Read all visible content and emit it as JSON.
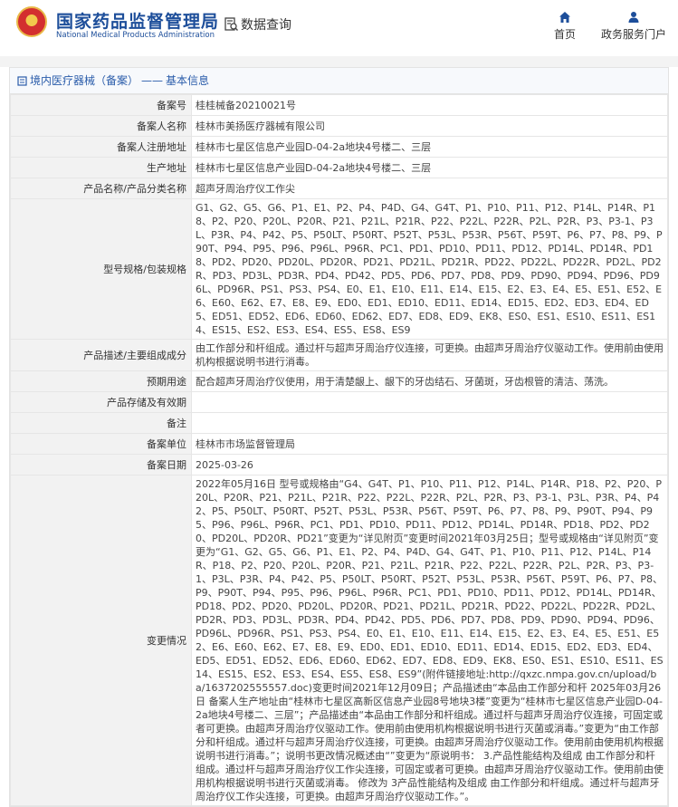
{
  "header": {
    "org_cn": "国家药品监督管理局",
    "org_en": "National Medical Products Administration",
    "query_label": "数据查询",
    "nav": [
      {
        "label": "首页"
      },
      {
        "label": "政务服务门户"
      }
    ]
  },
  "panel": {
    "breadcrumb": "境内医疗器械（备案）",
    "sep": "——",
    "section": "基本信息"
  },
  "rows": [
    {
      "label": "备案号",
      "value": "桂桂械备20210021号"
    },
    {
      "label": "备案人名称",
      "value": "桂林市美扬医疗器械有限公司"
    },
    {
      "label": "备案人注册地址",
      "value": "桂林市七星区信息产业园D-04-2a地块4号楼二、三层"
    },
    {
      "label": "生产地址",
      "value": "桂林市七星区信息产业园D-04-2a地块4号楼二、三层"
    },
    {
      "label": "产品名称/产品分类名称",
      "value": "超声牙周治疗仪工作尖"
    },
    {
      "label": "型号规格/包装规格",
      "value": "G1、G2、G5、G6、P1、E1、P2、P4、P4D、G4、G4T、P1、P10、P11、P12、P14L、P14R、P18、P2、P20、P20L、P20R、P21、P21L、P21R、P22、P22L、P22R、P2L、P2R、P3、P3-1、P3L、P3R、P4、P42、P5、P50LT、P50RT、P52T、P53L、P53R、P56T、P59T、P6、P7、P8、P9、P90T、P94、P95、P96、P96L、P96R、PC1、PD1、PD10、PD11、PD12、PD14L、PD14R、PD18、PD2、PD20、PD20L、PD20R、PD21、PD21L、PD21R、PD22、PD22L、PD22R、PD2L、PD2R、PD3、PD3L、PD3R、PD4、PD42、PD5、PD6、PD7、PD8、PD9、PD90、PD94、PD96、PD96L、PD96R、PS1、PS3、PS4、E0、E1、E10、E11、E14、E15、E2、E3、E4、E5、E51、E52、E6、E60、E62、E7、E8、E9、ED0、ED1、ED10、ED11、ED14、ED15、ED2、ED3、ED4、ED5、ED51、ED52、ED6、ED60、ED62、ED7、ED8、ED9、EK8、ES0、ES1、ES10、ES11、ES14、ES15、ES2、ES3、ES4、ES5、ES8、ES9"
    },
    {
      "label": "产品描述/主要组成成分",
      "value": "由工作部分和杆组成。通过杆与超声牙周治疗仪连接，可更换。由超声牙周治疗仪驱动工作。使用前由使用机构根据说明书进行消毒。"
    },
    {
      "label": "预期用途",
      "value": "配合超声牙周治疗仪使用，用于清楚龈上、龈下的牙齿结石、牙菌斑，牙齿根管的清洁、荡洗。"
    },
    {
      "label": "产品存储及有效期",
      "value": ""
    },
    {
      "label": "备注",
      "value": ""
    },
    {
      "label": "备案单位",
      "value": "桂林市市场监督管理局"
    },
    {
      "label": "备案日期",
      "value": "2025-03-26"
    },
    {
      "label": "变更情况",
      "value": "2022年05月16日 型号或规格由“G4、G4T、P1、P10、P11、P12、P14L、P14R、P18、P2、P20、P20L、P20R、P21、P21L、P21R、P22、P22L、P22R、P2L、P2R、P3、P3-1、P3L、P3R、P4、P42、P5、P50LT、P50RT、P52T、P53L、P53R、P56T、P59T、P6、P7、P8、P9、P90T、P94、P95、P96、P96L、P96R、PC1、PD1、PD10、PD11、PD12、PD14L、PD14R、PD18、PD2、PD20、PD20L、PD20R、PD21”变更为“详见附页”变更时间2021年03月25日；型号或规格由“详见附页”变更为“G1、G2、G5、G6、P1、E1、P2、P4、P4D、G4、G4T、P1、P10、P11、P12、P14L、P14R、P18、P2、P20、P20L、P20R、P21、P21L、P21R、P22、P22L、P22R、P2L、P2R、P3、P3-1、P3L、P3R、P4、P42、P5、P50LT、P50RT、P52T、P53L、P53R、P56T、P59T、P6、P7、P8、P9、P90T、P94、P95、P96、P96L、P96R、PC1、PD1、PD10、PD11、PD12、PD14L、PD14R、PD18、PD2、PD20、PD20L、PD20R、PD21、PD21L、PD21R、PD22、PD22L、PD22R、PD2L、PD2R、PD3、PD3L、PD3R、PD4、PD42、PD5、PD6、PD7、PD8、PD9、PD90、PD94、PD96、PD96L、PD96R、PS1、PS3、PS4、E0、E1、E10、E11、E14、E15、E2、E3、E4、E5、E51、E52、E6、E60、E62、E7、E8、E9、ED0、ED1、ED10、ED11、ED14、ED15、ED2、ED3、ED4、ED5、ED51、ED52、ED6、ED60、ED62、ED7、ED8、ED9、EK8、ES0、ES1、ES10、ES11、ES14、ES15、ES2、ES3、ES4、ES5、ES8、ES9”(附件链接地址:http://qxzc.nmpa.gov.cn/upload/ba/1637202555557.doc)变更时间2021年12月09日；产品描述由“本品由工作部分和杆 2025年03月26日 备案人生产地址由“桂林市七星区高新区信息产业园8号地块3楼”变更为“桂林市七星区信息产业园D-04-2a地块4号楼二、三层”；产品描述由“本品由工作部分和杆组成。通过杆与超声牙周治疗仪连接，可固定或者可更换。由超声牙周治疗仪驱动工作。使用前由使用机构根据说明书进行灭菌或消毒。”变更为“由工作部分和杆组成。通过杆与超声牙周治疗仪连接，可更换。由超声牙周治疗仪驱动工作。使用前由使用机构根据说明书进行消毒。”；说明书更改情况概述由“”变更为“原说明书： 3.产品性能结构及组成 由工作部分和杆组成。通过杆与超声牙周治疗仪工作尖连接，可固定或者可更换。由超声牙周治疗仪驱动工作。使用前由使用机构根据说明书进行灭菌或消毒。 修改为 3产品性能结构及组成 由工作部分和杆组成。通过杆与超声牙周治疗仪工作尖连接，可更换。由超声牙周治疗仪驱动工作。”。"
    }
  ]
}
